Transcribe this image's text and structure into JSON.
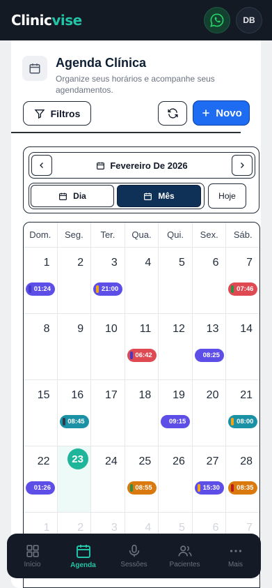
{
  "brand": {
    "part1": "Clinic",
    "part2": "vise"
  },
  "user": {
    "initials": "DB"
  },
  "header": {
    "title": "Agenda Clínica",
    "subtitle": "Organize seus horários e acompanhe seus agendamentos."
  },
  "toolbar": {
    "filters_label": "Filtros",
    "new_label": "Novo"
  },
  "calendar": {
    "month_label": "Fevereiro De 2026",
    "view_day": "Dia",
    "view_month": "Mês",
    "today_label": "Hoje",
    "weekdays": [
      "Dom.",
      "Seg.",
      "Ter.",
      "Qua.",
      "Qui.",
      "Sex.",
      "Sáb."
    ],
    "weeks": [
      [
        {
          "d": "1",
          "ev": "01:24",
          "c": "purple",
          "m": "#4338ca"
        },
        {
          "d": "2"
        },
        {
          "d": "3",
          "ev": "21:00",
          "c": "purple",
          "m": "#f2a516"
        },
        {
          "d": "4"
        },
        {
          "d": "5"
        },
        {
          "d": "6"
        },
        {
          "d": "7",
          "ev": "07:46",
          "c": "red",
          "m": "#2f8f46"
        }
      ],
      [
        {
          "d": "8"
        },
        {
          "d": "9"
        },
        {
          "d": "10"
        },
        {
          "d": "11",
          "ev": "06:42",
          "c": "red",
          "m": "#4338ca"
        },
        {
          "d": "12"
        },
        {
          "d": "13",
          "ev": "08:25",
          "c": "purple",
          "m": ""
        },
        {
          "d": "14"
        }
      ],
      [
        {
          "d": "15"
        },
        {
          "d": "16",
          "ev": "08:45",
          "c": "teal",
          "m": "#2b3a4a"
        },
        {
          "d": "17"
        },
        {
          "d": "18"
        },
        {
          "d": "19",
          "ev": "09:15",
          "c": "purple",
          "m": ""
        },
        {
          "d": "20"
        },
        {
          "d": "21",
          "ev": "08:00",
          "c": "teal",
          "m": "#f2a516"
        }
      ],
      [
        {
          "d": "22",
          "ev": "01:26",
          "c": "purple",
          "m": ""
        },
        {
          "d": "23",
          "today": true
        },
        {
          "d": "24"
        },
        {
          "d": "25",
          "ev": "08:55",
          "c": "orange",
          "m": "#2f8f46"
        },
        {
          "d": "26"
        },
        {
          "d": "27",
          "ev": "15:30",
          "c": "purple",
          "m": "#f2a516"
        },
        {
          "d": "28",
          "ev": "08:35",
          "c": "orange",
          "m": "#b91c1c"
        }
      ],
      [
        {
          "d": "1",
          "faded": true
        },
        {
          "d": "2",
          "faded": true
        },
        {
          "d": "3",
          "faded": true
        },
        {
          "d": "4",
          "faded": true
        },
        {
          "d": "5",
          "faded": true
        },
        {
          "d": "6",
          "faded": true
        },
        {
          "d": "7",
          "faded": true
        }
      ]
    ]
  },
  "nav": [
    {
      "label": "Início",
      "icon": "grid-icon"
    },
    {
      "label": "Agenda",
      "icon": "calendar-icon",
      "active": true
    },
    {
      "label": "Sessões",
      "icon": "microphone-icon"
    },
    {
      "label": "Pacientes",
      "icon": "users-icon"
    },
    {
      "label": "Mais",
      "icon": "more-icon"
    }
  ]
}
